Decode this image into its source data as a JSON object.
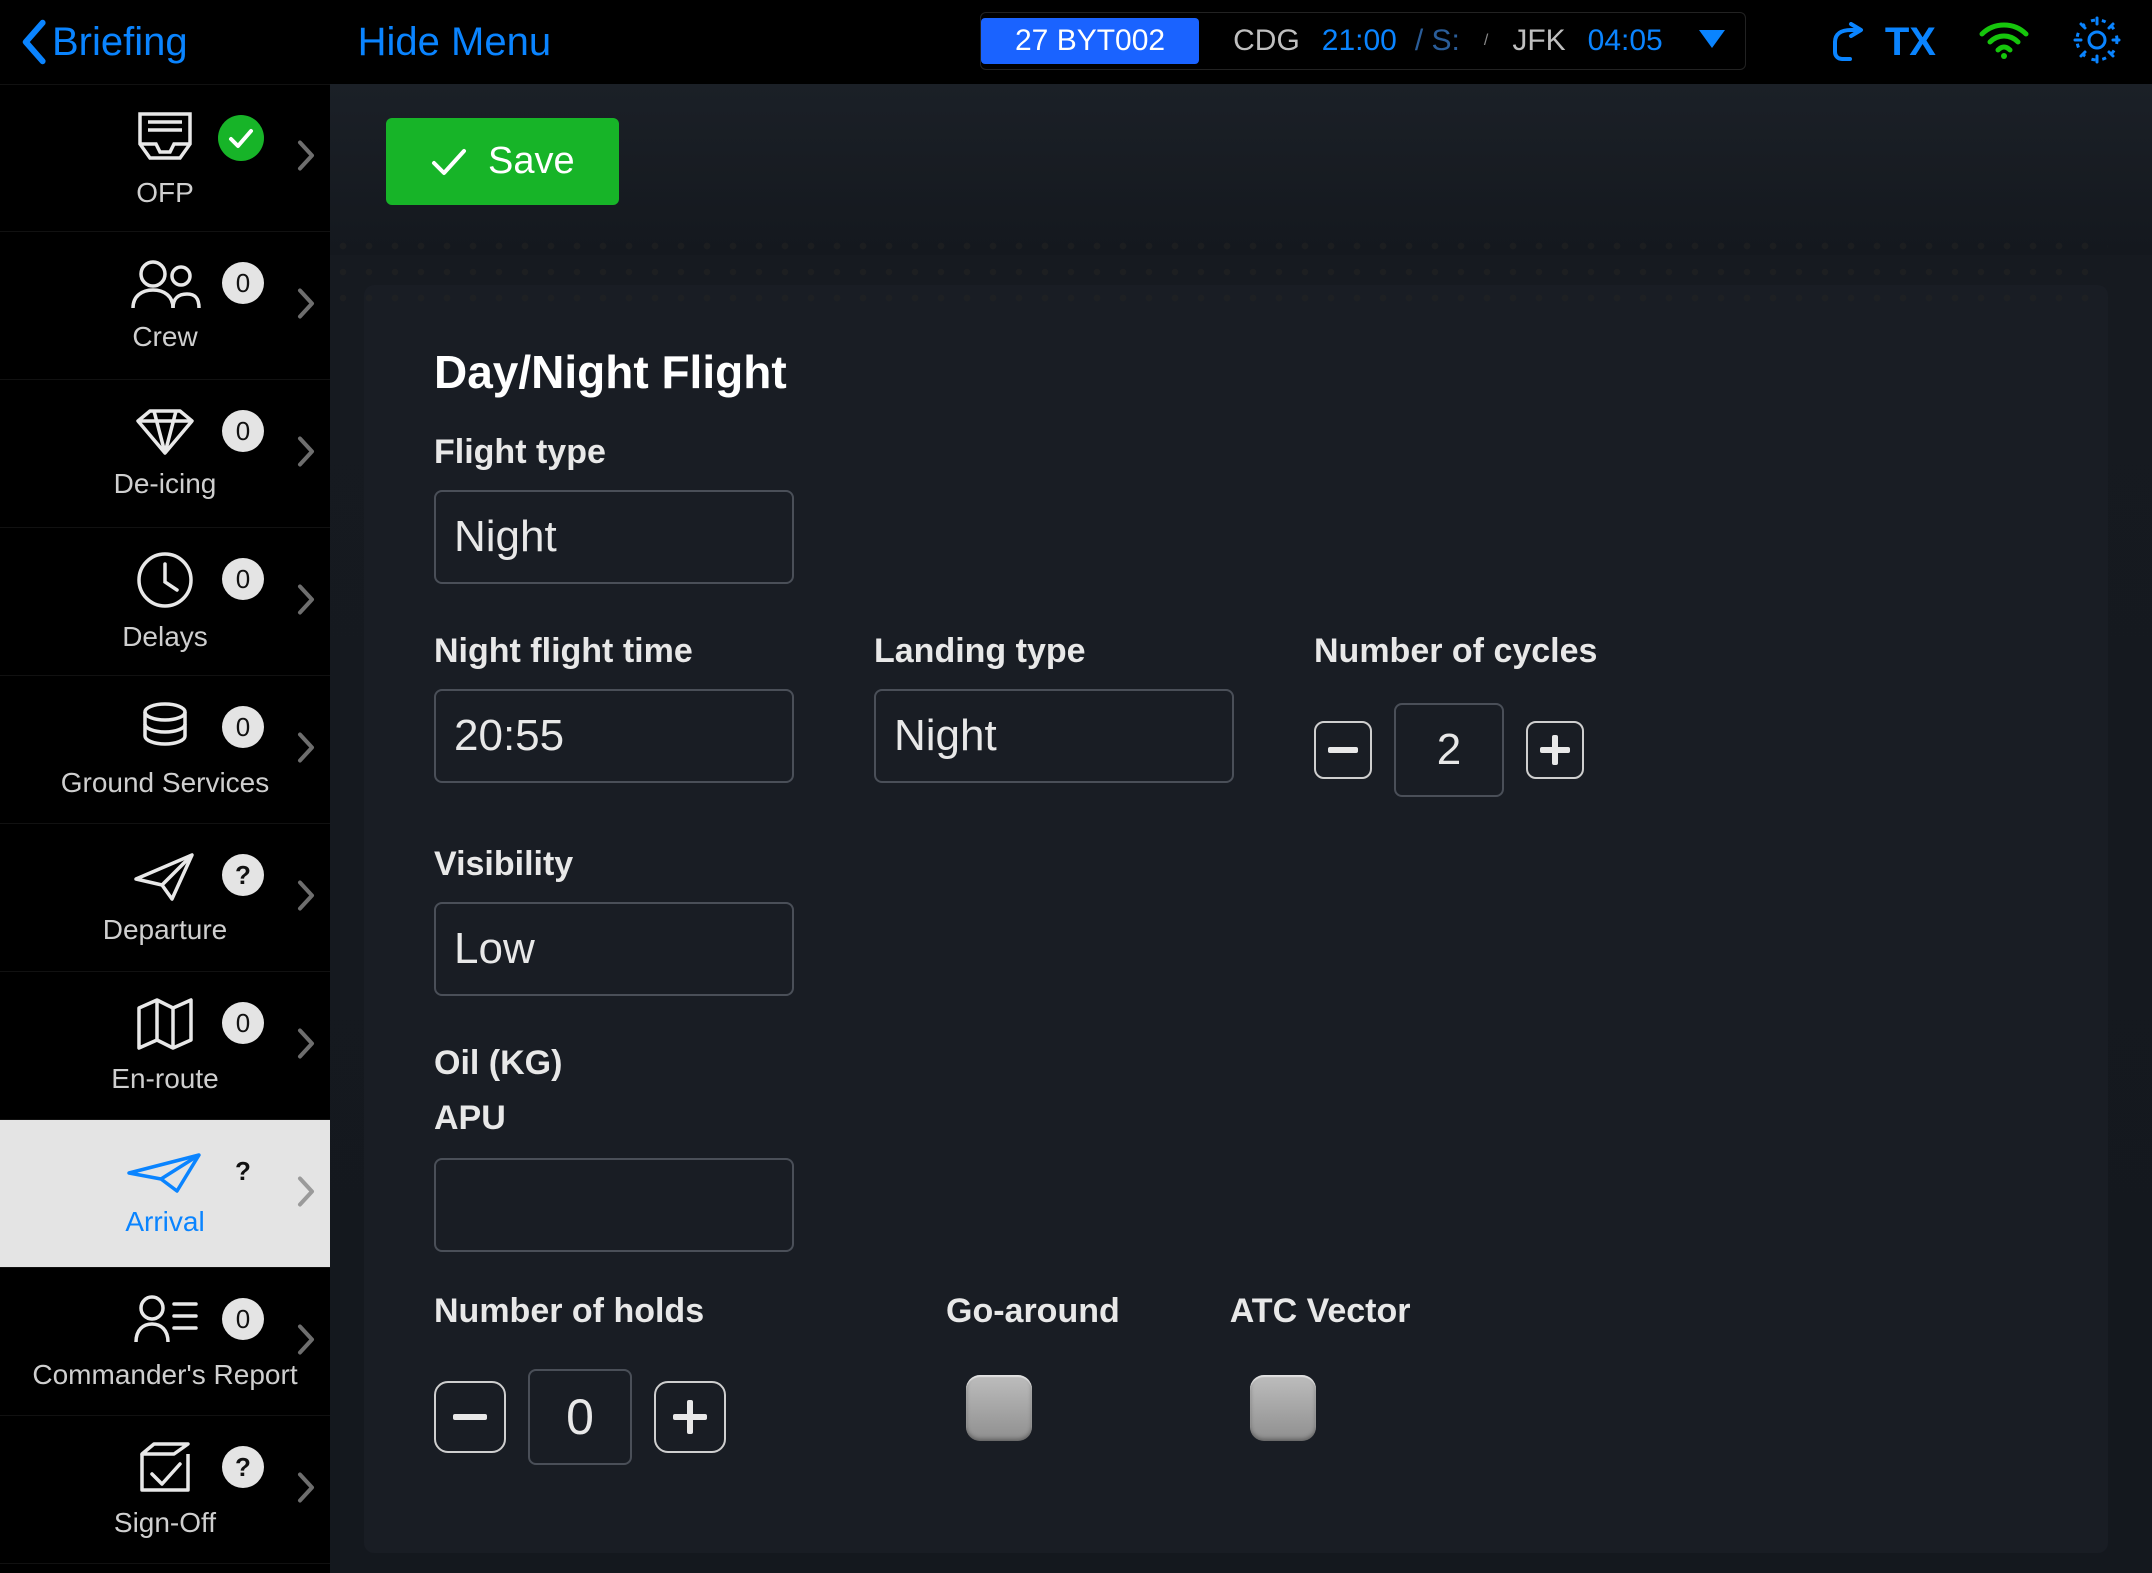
{
  "header": {
    "back_label": "Briefing",
    "hide_menu_label": "Hide Menu",
    "flight_badge": "27 BYT002",
    "dep_code": "CDG",
    "dep_time": "21:00",
    "dep_suffix": "/ S:",
    "arr_code": "JFK",
    "arr_time": "04:05",
    "tx_label": "TX"
  },
  "sidebar": [
    {
      "key": "ofp",
      "label": "OFP",
      "badge": null,
      "check": true,
      "q": false
    },
    {
      "key": "crew",
      "label": "Crew",
      "badge": "0",
      "check": false,
      "q": false
    },
    {
      "key": "deicing",
      "label": "De-icing",
      "badge": "0",
      "check": false,
      "q": false
    },
    {
      "key": "delays",
      "label": "Delays",
      "badge": "0",
      "check": false,
      "q": false
    },
    {
      "key": "ground",
      "label": "Ground Services",
      "badge": "0",
      "check": false,
      "q": false
    },
    {
      "key": "departure",
      "label": "Departure",
      "badge": "?",
      "check": false,
      "q": true
    },
    {
      "key": "enroute",
      "label": "En-route",
      "badge": "0",
      "check": false,
      "q": false
    },
    {
      "key": "arrival",
      "label": "Arrival",
      "badge": "?",
      "check": false,
      "q": true
    },
    {
      "key": "commander",
      "label": "Commander's Report",
      "badge": "0",
      "check": false,
      "q": false
    },
    {
      "key": "signoff",
      "label": "Sign-Off",
      "badge": "?",
      "check": false,
      "q": true
    }
  ],
  "active_sidebar": "arrival",
  "save_label": "Save",
  "form": {
    "title": "Day/Night Flight",
    "flight_type_label": "Flight type",
    "flight_type_value": "Night",
    "night_time_label": "Night flight time",
    "night_time_value": "20:55",
    "landing_type_label": "Landing type",
    "landing_type_value": "Night",
    "cycles_label": "Number of cycles",
    "cycles_value": "2",
    "visibility_label": "Visibility",
    "visibility_value": "Low",
    "oil_label": "Oil (KG)",
    "apu_label": "APU",
    "apu_value": "",
    "holds_label": "Number of holds",
    "holds_value": "0",
    "go_around_label": "Go-around",
    "atc_vector_label": "ATC Vector"
  }
}
